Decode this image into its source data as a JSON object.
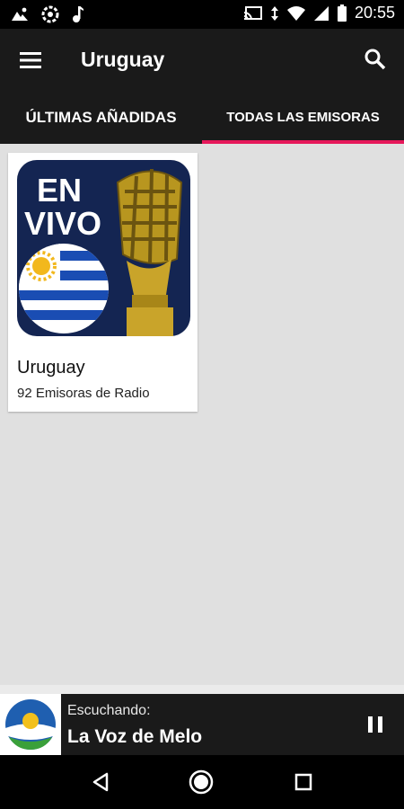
{
  "status_bar": {
    "time": "20:55",
    "left_icons": [
      "photos-icon",
      "settings-icon",
      "music-note-icon"
    ],
    "right_icons": [
      "cast-icon",
      "data-arrows-icon",
      "wifi-icon",
      "signal-icon",
      "battery-icon"
    ]
  },
  "toolbar": {
    "title": "Uruguay",
    "menu_icon": "hamburger-menu-icon",
    "search_icon": "search-icon"
  },
  "tabs": [
    {
      "label": "ÚLTIMAS AÑADIDAS",
      "selected": false
    },
    {
      "label": "TODAS LAS EMISORAS",
      "selected": true
    }
  ],
  "accent_color": "#e6185a",
  "cards": [
    {
      "image_text_line1": "EN",
      "image_text_line2": "VIVO",
      "title": "Uruguay",
      "subtitle": "92 Emisoras de Radio"
    }
  ],
  "player": {
    "caption": "Escuchando:",
    "station": "La Voz de Melo",
    "control_icon": "pause-icon"
  },
  "nav_bar": {
    "icons": [
      "back-icon",
      "home-icon",
      "recents-icon"
    ]
  }
}
